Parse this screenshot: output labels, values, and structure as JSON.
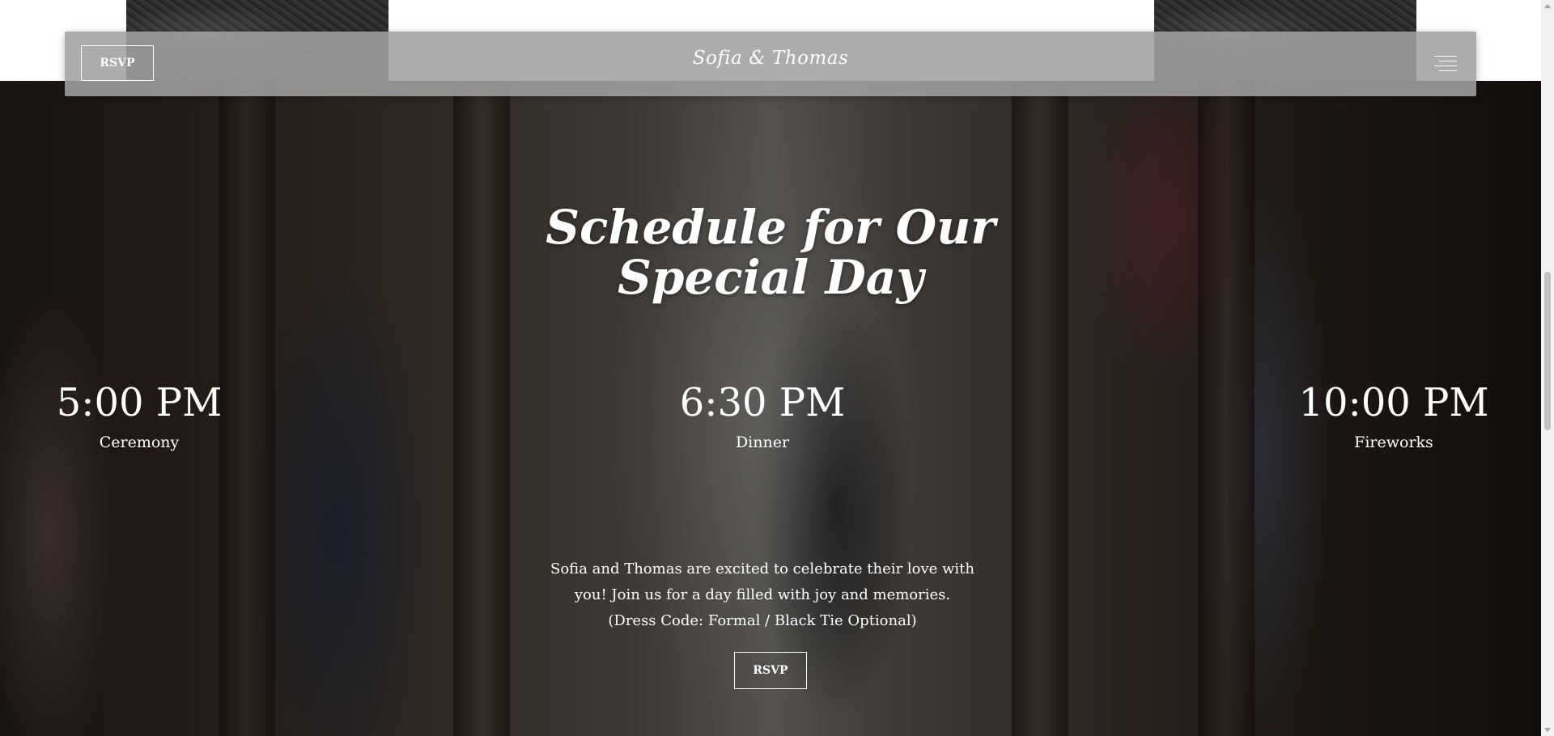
{
  "header": {
    "rsvp_label": "RSVP",
    "brand": "Sofia & Thomas",
    "menu_icon": "hamburger-menu-icon"
  },
  "schedule": {
    "title_line1": "Schedule for Our",
    "title_line2": "Special Day",
    "events": [
      {
        "time": "5:00 PM",
        "label": "Ceremony"
      },
      {
        "time": "6:30 PM",
        "label": "Dinner"
      },
      {
        "time": "10:00 PM",
        "label": "Fireworks"
      }
    ],
    "message_lines": [
      "Sofia and Thomas are excited to celebrate their love with",
      "you! Join us for a day filled with joy and memories.",
      "(Dress Code: Formal / Black Tie Optional)"
    ],
    "cta_label": "RSVP"
  },
  "colors": {
    "text": "#ffffff",
    "header_bg": "#a0a0a0"
  }
}
